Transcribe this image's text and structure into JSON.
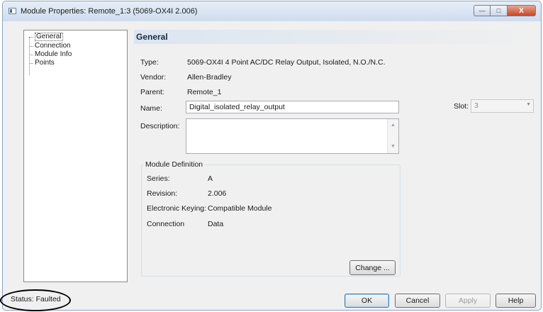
{
  "window": {
    "title": "Module Properties: Remote_1:3 (5069-OX4I 2.006)",
    "caption_buttons": {
      "minimize": "—",
      "maximize": "□",
      "close": "X"
    }
  },
  "tree": {
    "items": [
      {
        "label": "General",
        "selected": true
      },
      {
        "label": "Connection"
      },
      {
        "label": "Module Info"
      },
      {
        "label": "Points"
      }
    ]
  },
  "panel": {
    "title": "General",
    "type": {
      "label": "Type:",
      "value": "5069-OX4I 4 Point AC/DC Relay Output, Isolated, N.O./N.C."
    },
    "vendor": {
      "label": "Vendor:",
      "value": "Allen-Bradley"
    },
    "parent": {
      "label": "Parent:",
      "value": "Remote_1"
    },
    "name": {
      "label": "Name:",
      "value": "Digital_isolated_relay_output"
    },
    "description": {
      "label": "Description:",
      "value": ""
    },
    "slot": {
      "label": "Slot:",
      "value": "3"
    }
  },
  "module_definition": {
    "title": "Module Definition",
    "series": {
      "label": "Series:",
      "value": "A"
    },
    "revision": {
      "label": "Revision:",
      "value": "2.006"
    },
    "keying": {
      "label": "Electronic Keying:",
      "value": "Compatible Module"
    },
    "connection": {
      "label": "Connection",
      "value": "Data"
    },
    "change_button": "Change ..."
  },
  "status": {
    "text": "Status:  Faulted"
  },
  "buttons": {
    "ok": "OK",
    "cancel": "Cancel",
    "apply": "Apply",
    "help": "Help"
  }
}
